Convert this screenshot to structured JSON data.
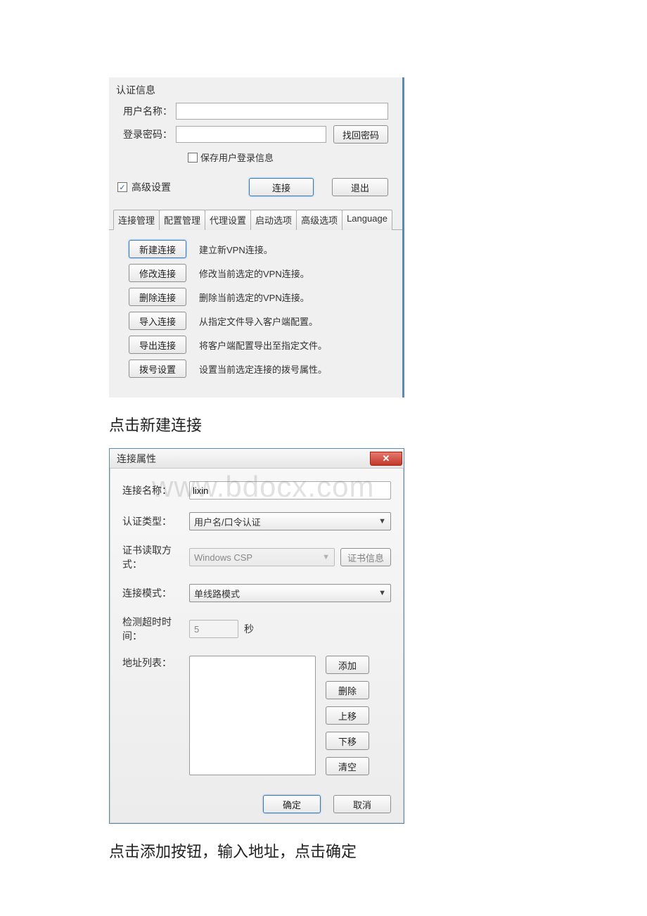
{
  "auth": {
    "group_title": "认证信息",
    "username_label": "用户名称：",
    "password_label": "登录密码：",
    "find_password_btn": "找回密码",
    "save_login_label": "保存用户登录信息",
    "advanced_label": "高级设置",
    "connect_btn": "连接",
    "exit_btn": "退出"
  },
  "tabs": {
    "t0": "连接管理",
    "t1": "配置管理",
    "t2": "代理设置",
    "t3": "启动选项",
    "t4": "高级选项",
    "t5": "Language"
  },
  "mgmt": {
    "new_btn": "新建连接",
    "new_desc": "建立新VPN连接。",
    "edit_btn": "修改连接",
    "edit_desc": "修改当前选定的VPN连接。",
    "del_btn": "删除连接",
    "del_desc": "删除当前选定的VPN连接。",
    "import_btn": "导入连接",
    "import_desc": "从指定文件导入客户端配置。",
    "export_btn": "导出连接",
    "export_desc": "将客户端配置导出至指定文件。",
    "dial_btn": "拨号设置",
    "dial_desc": "设置当前选定连接的拨号属性。"
  },
  "instruction1": "点击新建连接",
  "dialog2": {
    "title": "连接属性",
    "name_label": "连接名称：",
    "name_value": "lixin",
    "auth_type_label": "认证类型：",
    "auth_type_value": "用户名/口令认证",
    "cert_mode_label": "证书读取方式：",
    "cert_mode_value": "Windows CSP",
    "cert_info_btn": "证书信息",
    "conn_mode_label": "连接模式：",
    "conn_mode_value": "单线路模式",
    "timeout_label": "检测超时时间：",
    "timeout_value": "5",
    "timeout_unit": "秒",
    "addr_label": "地址列表：",
    "add_btn": "添加",
    "del_btn": "删除",
    "up_btn": "上移",
    "down_btn": "下移",
    "clear_btn": "清空",
    "ok_btn": "确定",
    "cancel_btn": "取消"
  },
  "watermark": "www.bdocx.com",
  "instruction2": "点击添加按钮，输入地址，点击确定"
}
